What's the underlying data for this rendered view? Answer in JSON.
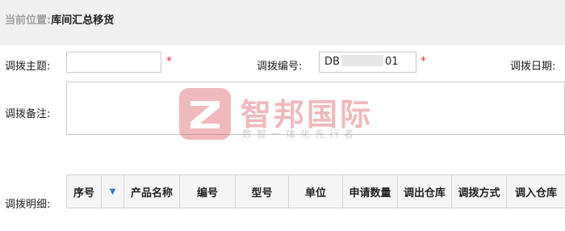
{
  "breadcrumb": {
    "prefix": "当前位置:",
    "current": "库间汇总移货"
  },
  "form": {
    "subject_label": "调拨主题:",
    "subject_value": "",
    "number_label": "调拨编号:",
    "number_prefix": "DB",
    "number_suffix": "01",
    "date_label": "调拨日期:",
    "remark_label": "调拨备注:",
    "remark_value": "",
    "details_label": "调拨明细:",
    "required_mark": "*"
  },
  "watermark": {
    "title": "智邦国际",
    "slogan": "数智一体化先行者",
    "logo_letter": "Z",
    "brand_color": "#d23a45"
  },
  "table": {
    "columns": [
      "序号",
      "▼",
      "产品名称",
      "编号",
      "型号",
      "单位",
      "申请数量",
      "调出仓库",
      "调拨方式",
      "调入仓库"
    ],
    "sort_icon": "sort-down-icon"
  },
  "colors": {
    "required": "#e0303a",
    "accent": "#3a78c4"
  }
}
